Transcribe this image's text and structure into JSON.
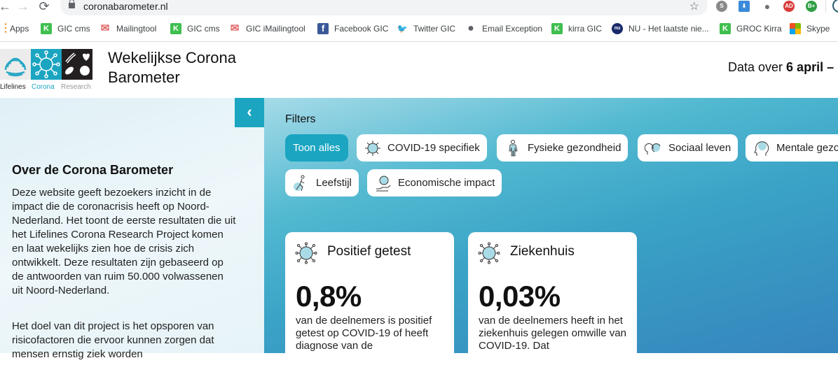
{
  "browser": {
    "url": "coronabarometer.nl",
    "nav": {
      "back": "←",
      "forward": "→",
      "reload": "⟳"
    },
    "bookmark_star": "☆",
    "extensions": [
      {
        "name": "skype-extension-icon",
        "label": "S",
        "color": "#8a8a8a"
      },
      {
        "name": "download-extension-icon",
        "label": "⬇",
        "color": "#3b8ad9"
      },
      {
        "name": "record-extension-icon",
        "label": "●",
        "color": "#707070"
      },
      {
        "name": "adblock-extension-icon",
        "label": "AD",
        "color": "#d93b3b"
      },
      {
        "name": "bplus-extension-icon",
        "label": "B+",
        "color": "#2f9e44"
      }
    ],
    "bookmarks": [
      {
        "label": "Apps",
        "icon": "apps-grid-icon",
        "glyph": "⋮",
        "color": "#e8a33b"
      },
      {
        "label": "GIC cms",
        "icon": "kirra-k-icon",
        "glyph": "K",
        "color": "#3fbf4f"
      },
      {
        "label": "Mailingtool",
        "icon": "mail-envelope-icon",
        "glyph": "✉",
        "color": "#e06666"
      },
      {
        "label": "GIC cms",
        "icon": "kirra-k-icon",
        "glyph": "K",
        "color": "#3fbf4f"
      },
      {
        "label": "GIC iMailingtool",
        "icon": "mail-envelope-icon",
        "glyph": "✉",
        "color": "#e06666"
      },
      {
        "label": "Facebook GIC",
        "icon": "facebook-icon",
        "glyph": "f",
        "color": "#3b5998"
      },
      {
        "label": "Twitter GIC",
        "icon": "twitter-bird-icon",
        "glyph": "🐦",
        "color": "#1da1f2"
      },
      {
        "label": "Email Exception",
        "icon": "globe-icon",
        "glyph": "●",
        "color": "#5f6368"
      },
      {
        "label": "kirra GIC",
        "icon": "kirra-k-icon",
        "glyph": "K",
        "color": "#3fbf4f"
      },
      {
        "label": "NU - Het laatste nie...",
        "icon": "nu-icon",
        "glyph": "nu",
        "color": "#1a2b6b"
      },
      {
        "label": "GROC Kirra",
        "icon": "kirra-k-icon",
        "glyph": "K",
        "color": "#3fbf4f"
      },
      {
        "label": "Skype",
        "icon": "microsoft-logo-icon",
        "glyph": "▦",
        "color": "#f25022"
      }
    ]
  },
  "header": {
    "logo_captions": {
      "lifelines": "Lifelines",
      "corona": "Corona",
      "research": "Research"
    },
    "title": "Wekelijkse Corona Barometer",
    "data_over_prefix": "Data over ",
    "data_over_date": "6 april –"
  },
  "sidebar": {
    "collapse_glyph": "‹",
    "about_title": "Over de Corona Barometer",
    "paragraphs": [
      "Deze website geeft bezoekers inzicht in de impact die de coronacrisis heeft op Noord-Nederland. Het toont de eerste resultaten die uit het Lifelines Corona Research Project komen en laat wekelijks zien hoe de crisis zich ontwikkelt. Deze resultaten zijn gebaseerd op de antwoorden van ruim 50.000 volwassenen uit Noord-Nederland.",
      "Het doel van dit project is het opsporen van risicofactoren die ervoor kunnen zorgen dat mensen ernstig ziek worden"
    ]
  },
  "filters": {
    "label": "Filters",
    "chips": [
      {
        "label": "Toon alles",
        "active": true
      },
      {
        "label": "COVID-19 specifiek",
        "icon": "virus-icon"
      },
      {
        "label": "Fysieke gezondheid",
        "icon": "body-icon"
      },
      {
        "label": "Sociaal leven",
        "icon": "social-heads-icon"
      },
      {
        "label": "Mentale gezo",
        "icon": "brain-head-icon"
      },
      {
        "label": "Leefstijl",
        "icon": "runner-icon"
      },
      {
        "label": "Economische impact",
        "icon": "coin-hand-icon"
      }
    ]
  },
  "cards": [
    {
      "title": "Positief getest",
      "value": "0,8%",
      "description": "van de deelnemers is positief getest op COVID-19 of heeft diagnose van de"
    },
    {
      "title": "Ziekenhuis",
      "value": "0,03%",
      "description": "van de deelnemers heeft in het ziekenhuis gelegen omwille van COVID-19. Dat"
    }
  ],
  "colors": {
    "accent": "#1ba5c1",
    "gradient_start": "#a6dbe8",
    "gradient_end": "#3585bd"
  }
}
